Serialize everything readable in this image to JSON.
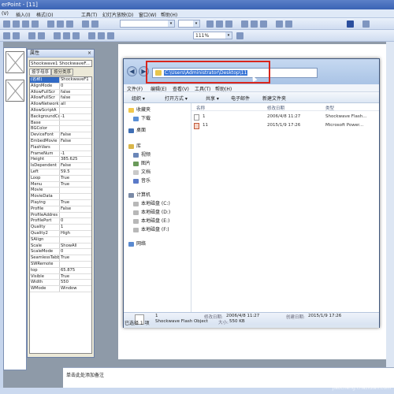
{
  "app": {
    "title": "erPoint - [11]"
  },
  "menubar": {
    "items": [
      "工具(T)",
      "幻灯片放映(D)",
      "窗口(W)",
      "帮助(H)"
    ],
    "partial_left": [
      "(V)",
      "插入(I)",
      "格式(O)"
    ]
  },
  "toolbar": {
    "zoom": "111%"
  },
  "properties": {
    "title": "属性",
    "close": "×",
    "object": "Shockwave1 ShockwaveF...",
    "tabs": [
      "按字母序",
      "按分类序"
    ],
    "rows": [
      [
        "(名称)",
        "ShockwaveF1"
      ],
      [
        "AlignMode",
        "0"
      ],
      [
        "AllowFullScr",
        "false"
      ],
      [
        "AllowFullScr",
        "false"
      ],
      [
        "AllowNetwork",
        "all"
      ],
      [
        "AllowScriptA",
        ""
      ],
      [
        "BackgroundCol",
        "-1"
      ],
      [
        "Base",
        ""
      ],
      [
        "BGColor",
        ""
      ],
      [
        "DeviceFont",
        "False"
      ],
      [
        "EmbedMovie",
        "False"
      ],
      [
        "FlashVars",
        ""
      ],
      [
        "FrameNum",
        "-1"
      ],
      [
        "Height",
        "385.625"
      ],
      [
        "IsDependent",
        "False"
      ],
      [
        "Left",
        "59.5"
      ],
      [
        "Loop",
        "True"
      ],
      [
        "Menu",
        "True"
      ],
      [
        "Movie",
        ""
      ],
      [
        "MovieData",
        ""
      ],
      [
        "Playing",
        "True"
      ],
      [
        "Profile",
        "False"
      ],
      [
        "ProfileAddres",
        ""
      ],
      [
        "ProfilePort",
        "0"
      ],
      [
        "Quality",
        "1"
      ],
      [
        "Quality2",
        "High"
      ],
      [
        "SAlign",
        ""
      ],
      [
        "Scale",
        "ShowAll"
      ],
      [
        "ScaleMode",
        "0"
      ],
      [
        "SeamlessTabb",
        "True"
      ],
      [
        "SWRemote",
        ""
      ],
      [
        "top",
        "65.875"
      ],
      [
        "Visible",
        "True"
      ],
      [
        "Width",
        "550"
      ],
      [
        "WMode",
        "Window"
      ]
    ]
  },
  "notes": {
    "placeholder": "单击此处添加备注"
  },
  "explorer": {
    "nav": {
      "back": "◀",
      "forward": "▶"
    },
    "address": "C:\\Users\\Administrator\\Desktop\\11",
    "menu": [
      "文件(F)",
      "编辑(E)",
      "查看(V)",
      "工具(T)",
      "帮助(H)"
    ],
    "commands": [
      "组织 ▾",
      "打开方式 ▾",
      "共享 ▾",
      "电子邮件",
      "新建文件夹"
    ],
    "nav_pane": [
      {
        "label": "收藏夹",
        "color": "#f2c84b"
      },
      {
        "label": "下载",
        "color": "#5a8fd6"
      },
      {
        "label": "桌面",
        "color": "#3f6fb5"
      },
      {
        "label": "库",
        "color": "#d9b64a"
      },
      {
        "label": "视频",
        "color": "#6a86b8"
      },
      {
        "label": "图片",
        "color": "#6a9a5a"
      },
      {
        "label": "文档",
        "color": "#c9c9c9"
      },
      {
        "label": "音乐",
        "color": "#5a7ac8"
      },
      {
        "label": "计算机",
        "color": "#7a8aa6"
      },
      {
        "label": "本地磁盘 (C:)",
        "color": "#b8b8b8"
      },
      {
        "label": "本地磁盘 (D:)",
        "color": "#b8b8b8"
      },
      {
        "label": "本地磁盘 (E:)",
        "color": "#b8b8b8"
      },
      {
        "label": "本地磁盘 (F:)",
        "color": "#b8b8b8"
      },
      {
        "label": "网络",
        "color": "#5a8ad0"
      }
    ],
    "columns": [
      "名称",
      "修改日期",
      "类型"
    ],
    "files": [
      {
        "name": "1",
        "date": "2006/4/8 11:27",
        "type": "Shockwave Flash..."
      },
      {
        "name": "11",
        "date": "2015/1/9 17:26",
        "type": "Microsoft Power..."
      }
    ],
    "details": {
      "name": "1",
      "type": "Shockwave Flash Object",
      "modified_label": "修改日期:",
      "modified": "2006/4/8 11:27",
      "created_label": "创建日期:",
      "created": "2015/1/9 17:26",
      "size_label": "大小:",
      "size": "550 KB"
    },
    "status": "已选择 1 项"
  },
  "watermark": {
    "text": "查字典 教程网",
    "url": "jiaocheng.chazidian.com"
  },
  "colors": {
    "highlight": "#d9261c",
    "selection": "#3875d7"
  }
}
